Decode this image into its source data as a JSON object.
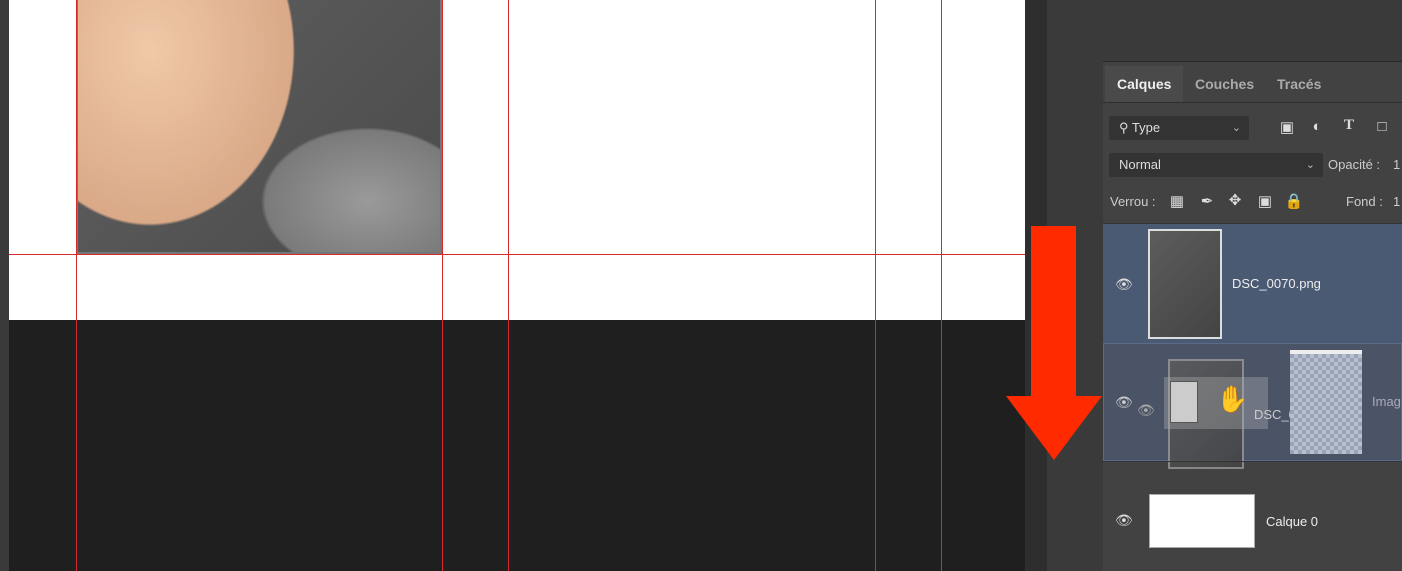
{
  "panel": {
    "tabs": [
      {
        "label": "Calques",
        "active": true
      },
      {
        "label": "Couches"
      },
      {
        "label": "Tracés"
      }
    ],
    "filter": {
      "label": "Type",
      "icon": "search-icon"
    },
    "filter_icons": [
      "image-filter-icon",
      "adjustment-filter-icon",
      "type-filter-icon",
      "shape-filter-icon"
    ],
    "blend_mode": "Normal",
    "opacity_label": "Opacité :",
    "opacity_value": "1",
    "lock_label": "Verrou :",
    "fill_label": "Fond :",
    "fill_value": "1"
  },
  "layers": [
    {
      "name": "DSC_0070.png",
      "selected": true,
      "visible": true
    },
    {
      "name": "DSC_0070.png",
      "dragging": true,
      "visible": true,
      "extra": "Imag"
    },
    {
      "name": "Calque 0",
      "visible": true
    }
  ],
  "colors": {
    "guide": "#d42a2a",
    "arrow": "#ff2a00",
    "selected_layer": "#4a5a72"
  }
}
